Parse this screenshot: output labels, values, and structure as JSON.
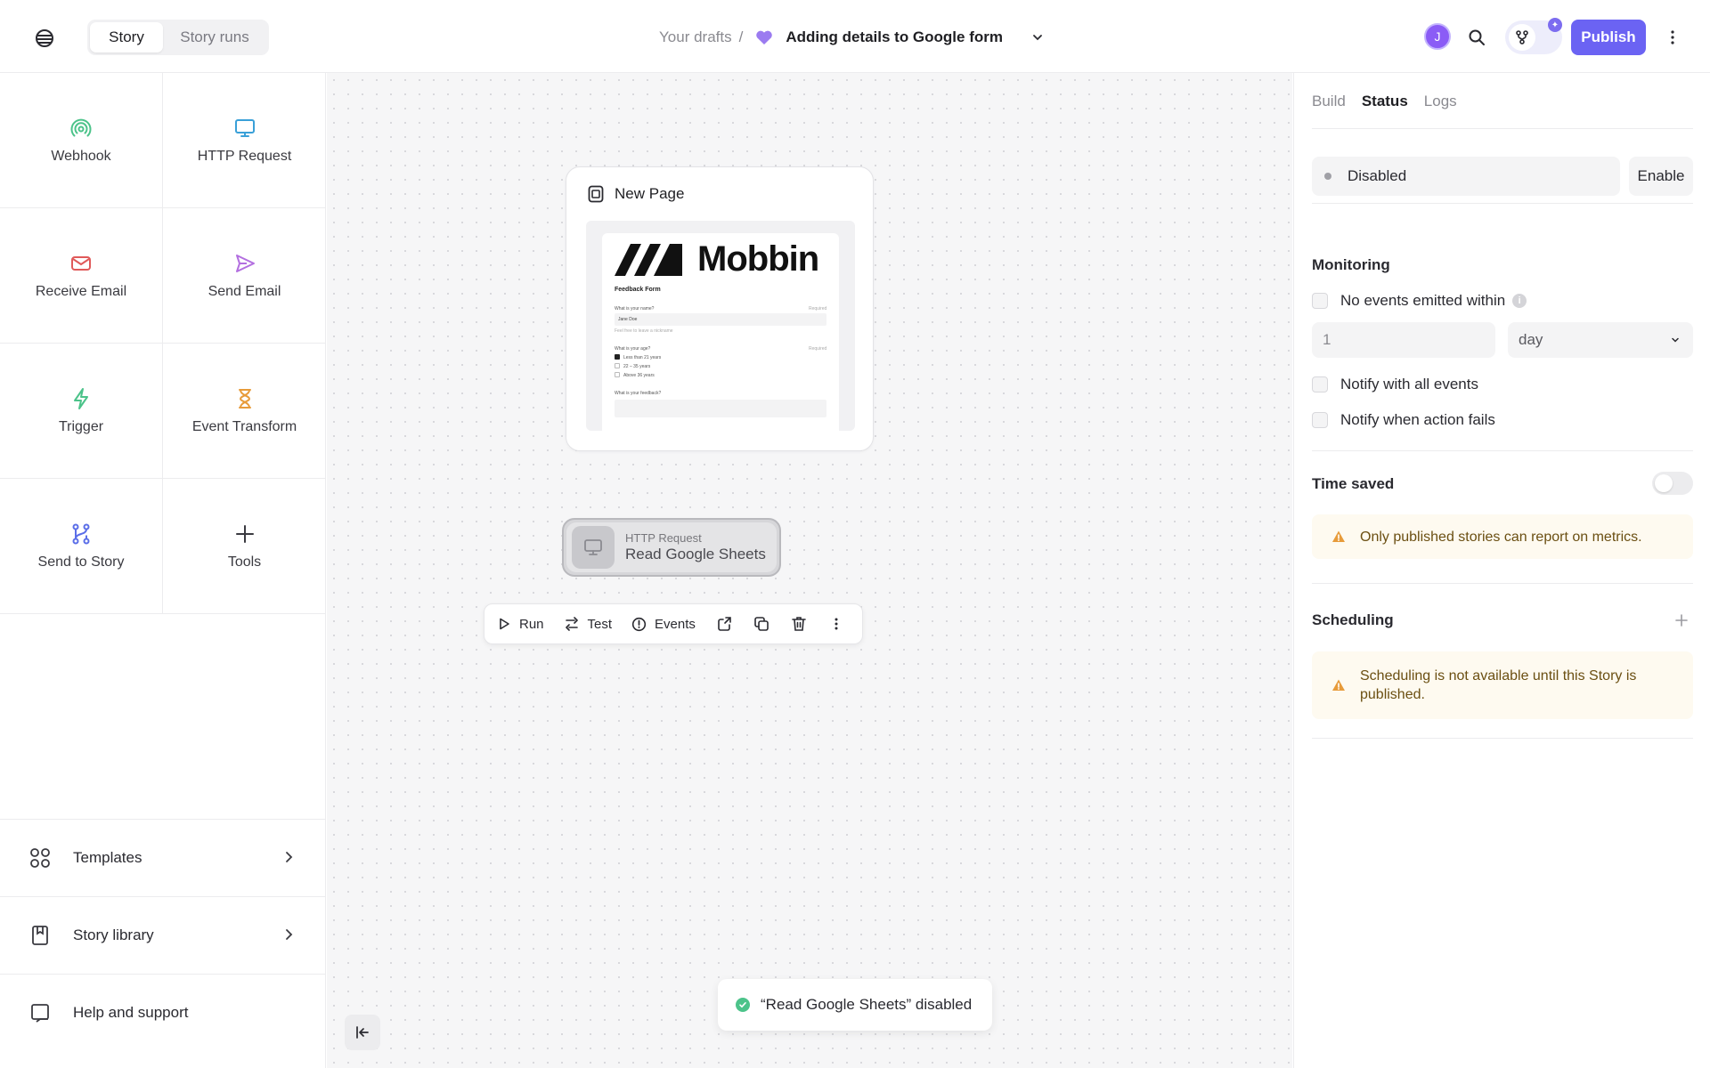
{
  "header": {
    "tabs": [
      {
        "label": "Story"
      },
      {
        "label": "Story runs"
      }
    ],
    "breadcrumb": {
      "parent": "Your drafts",
      "separator": "/",
      "title": "Adding details to Google form"
    },
    "avatar_initial": "J",
    "publish_label": "Publish",
    "accent_color": "#6b63f3"
  },
  "sidebar": {
    "tiles": [
      {
        "label": "Webhook",
        "icon": "webhook-icon"
      },
      {
        "label": "HTTP Request",
        "icon": "monitor-icon"
      },
      {
        "label": "Receive Email",
        "icon": "mail-icon"
      },
      {
        "label": "Send Email",
        "icon": "send-icon"
      },
      {
        "label": "Trigger",
        "icon": "bolt-icon"
      },
      {
        "label": "Event Transform",
        "icon": "hourglass-icon"
      },
      {
        "label": "Send to Story",
        "icon": "branch-icon"
      },
      {
        "label": "Tools",
        "icon": "plus-icon"
      }
    ],
    "bottom": [
      {
        "label": "Templates",
        "icon": "grid-icon"
      },
      {
        "label": "Story library",
        "icon": "book-icon"
      },
      {
        "label": "Help and support",
        "icon": "help-icon"
      }
    ]
  },
  "canvas": {
    "page_node": {
      "title": "New Page",
      "preview": {
        "brand": "Mobbin",
        "form_title": "Feedback Form",
        "q1": "What is your name?",
        "required": "Required",
        "q1_value": "Jane Doe",
        "q1_hint": "Feel free to leave a nickname",
        "q2": "What is your age?",
        "opt1": "Less than 21 years",
        "opt2": "22 – 35 years",
        "opt3": "Above 36 years",
        "q3": "What is your feedback?"
      }
    },
    "action_node": {
      "type": "HTTP Request",
      "name": "Read Google Sheets"
    },
    "action_bar": {
      "run": "Run",
      "test": "Test",
      "events": "Events"
    },
    "toast": "“Read Google Sheets” disabled"
  },
  "right_panel": {
    "tabs": [
      {
        "label": "Build"
      },
      {
        "label": "Status"
      },
      {
        "label": "Logs"
      }
    ],
    "status": {
      "value": "Disabled",
      "enable_label": "Enable"
    },
    "monitoring": {
      "title": "Monitoring",
      "no_events_label": "No events emitted within",
      "amount": "1",
      "unit": "day",
      "notify_all": "Notify with all events",
      "notify_fail": "Notify when action fails"
    },
    "time_saved": {
      "title": "Time saved",
      "warning": "Only published stories can report on metrics."
    },
    "scheduling": {
      "title": "Scheduling",
      "warning": "Scheduling is not available until this Story is published."
    }
  }
}
